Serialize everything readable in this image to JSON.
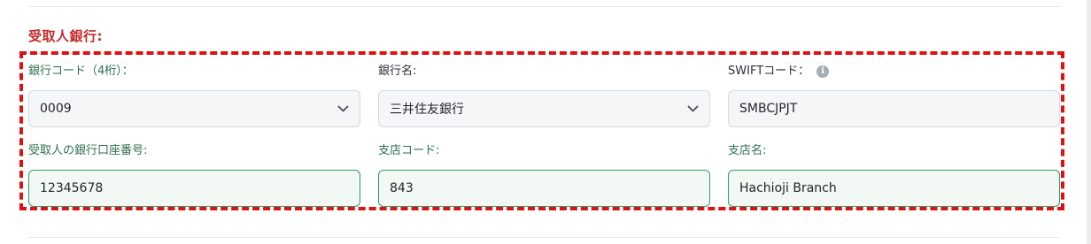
{
  "section": {
    "title": "受取人銀行:"
  },
  "fields": {
    "bank_code": {
      "label": "銀行コード（4桁）：",
      "value": "0009",
      "icon": "chevron-down-icon"
    },
    "bank_name": {
      "label": "銀行名:",
      "value": "三井住友銀行",
      "icon": "chevron-down-icon"
    },
    "swift_code": {
      "label": "SWIFTコード：",
      "value": "SMBCJPJT",
      "info_icon": "info-icon"
    },
    "account_number": {
      "label": "受取人の銀行口座番号:",
      "value": "12345678"
    },
    "branch_code": {
      "label": "支店コード:",
      "value": "843"
    },
    "branch_name": {
      "label": "支店名:",
      "value": "Hachioji Branch"
    }
  },
  "colors": {
    "section_title": "#c62828",
    "highlight_border": "#e01010",
    "label_green": "#2e6e4f",
    "field_green_border": "#2f9d6a"
  }
}
